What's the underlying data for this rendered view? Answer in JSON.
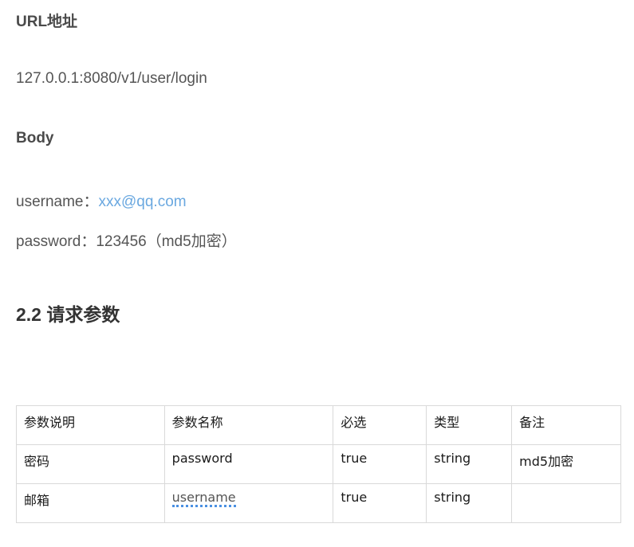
{
  "sections": {
    "url_heading": "URL地址",
    "url_value": "127.0.0.1:8080/v1/user/login",
    "body_heading": "Body",
    "username_label": "username：",
    "username_value": "xxx@qq.com",
    "password_label": "password：",
    "password_value": "123456（md5加密）",
    "params_heading": "2.2 请求参数"
  },
  "table": {
    "headers": [
      "参数说明",
      "参数名称",
      "必选",
      "类型",
      "备注"
    ],
    "rows": [
      [
        "密码",
        "password",
        "true",
        "string",
        "md5加密"
      ],
      [
        "邮箱",
        "username",
        "true",
        "string",
        ""
      ]
    ]
  },
  "colors": {
    "link": "#6aa8e0",
    "spellcheck_underline": "#4a90e2"
  }
}
